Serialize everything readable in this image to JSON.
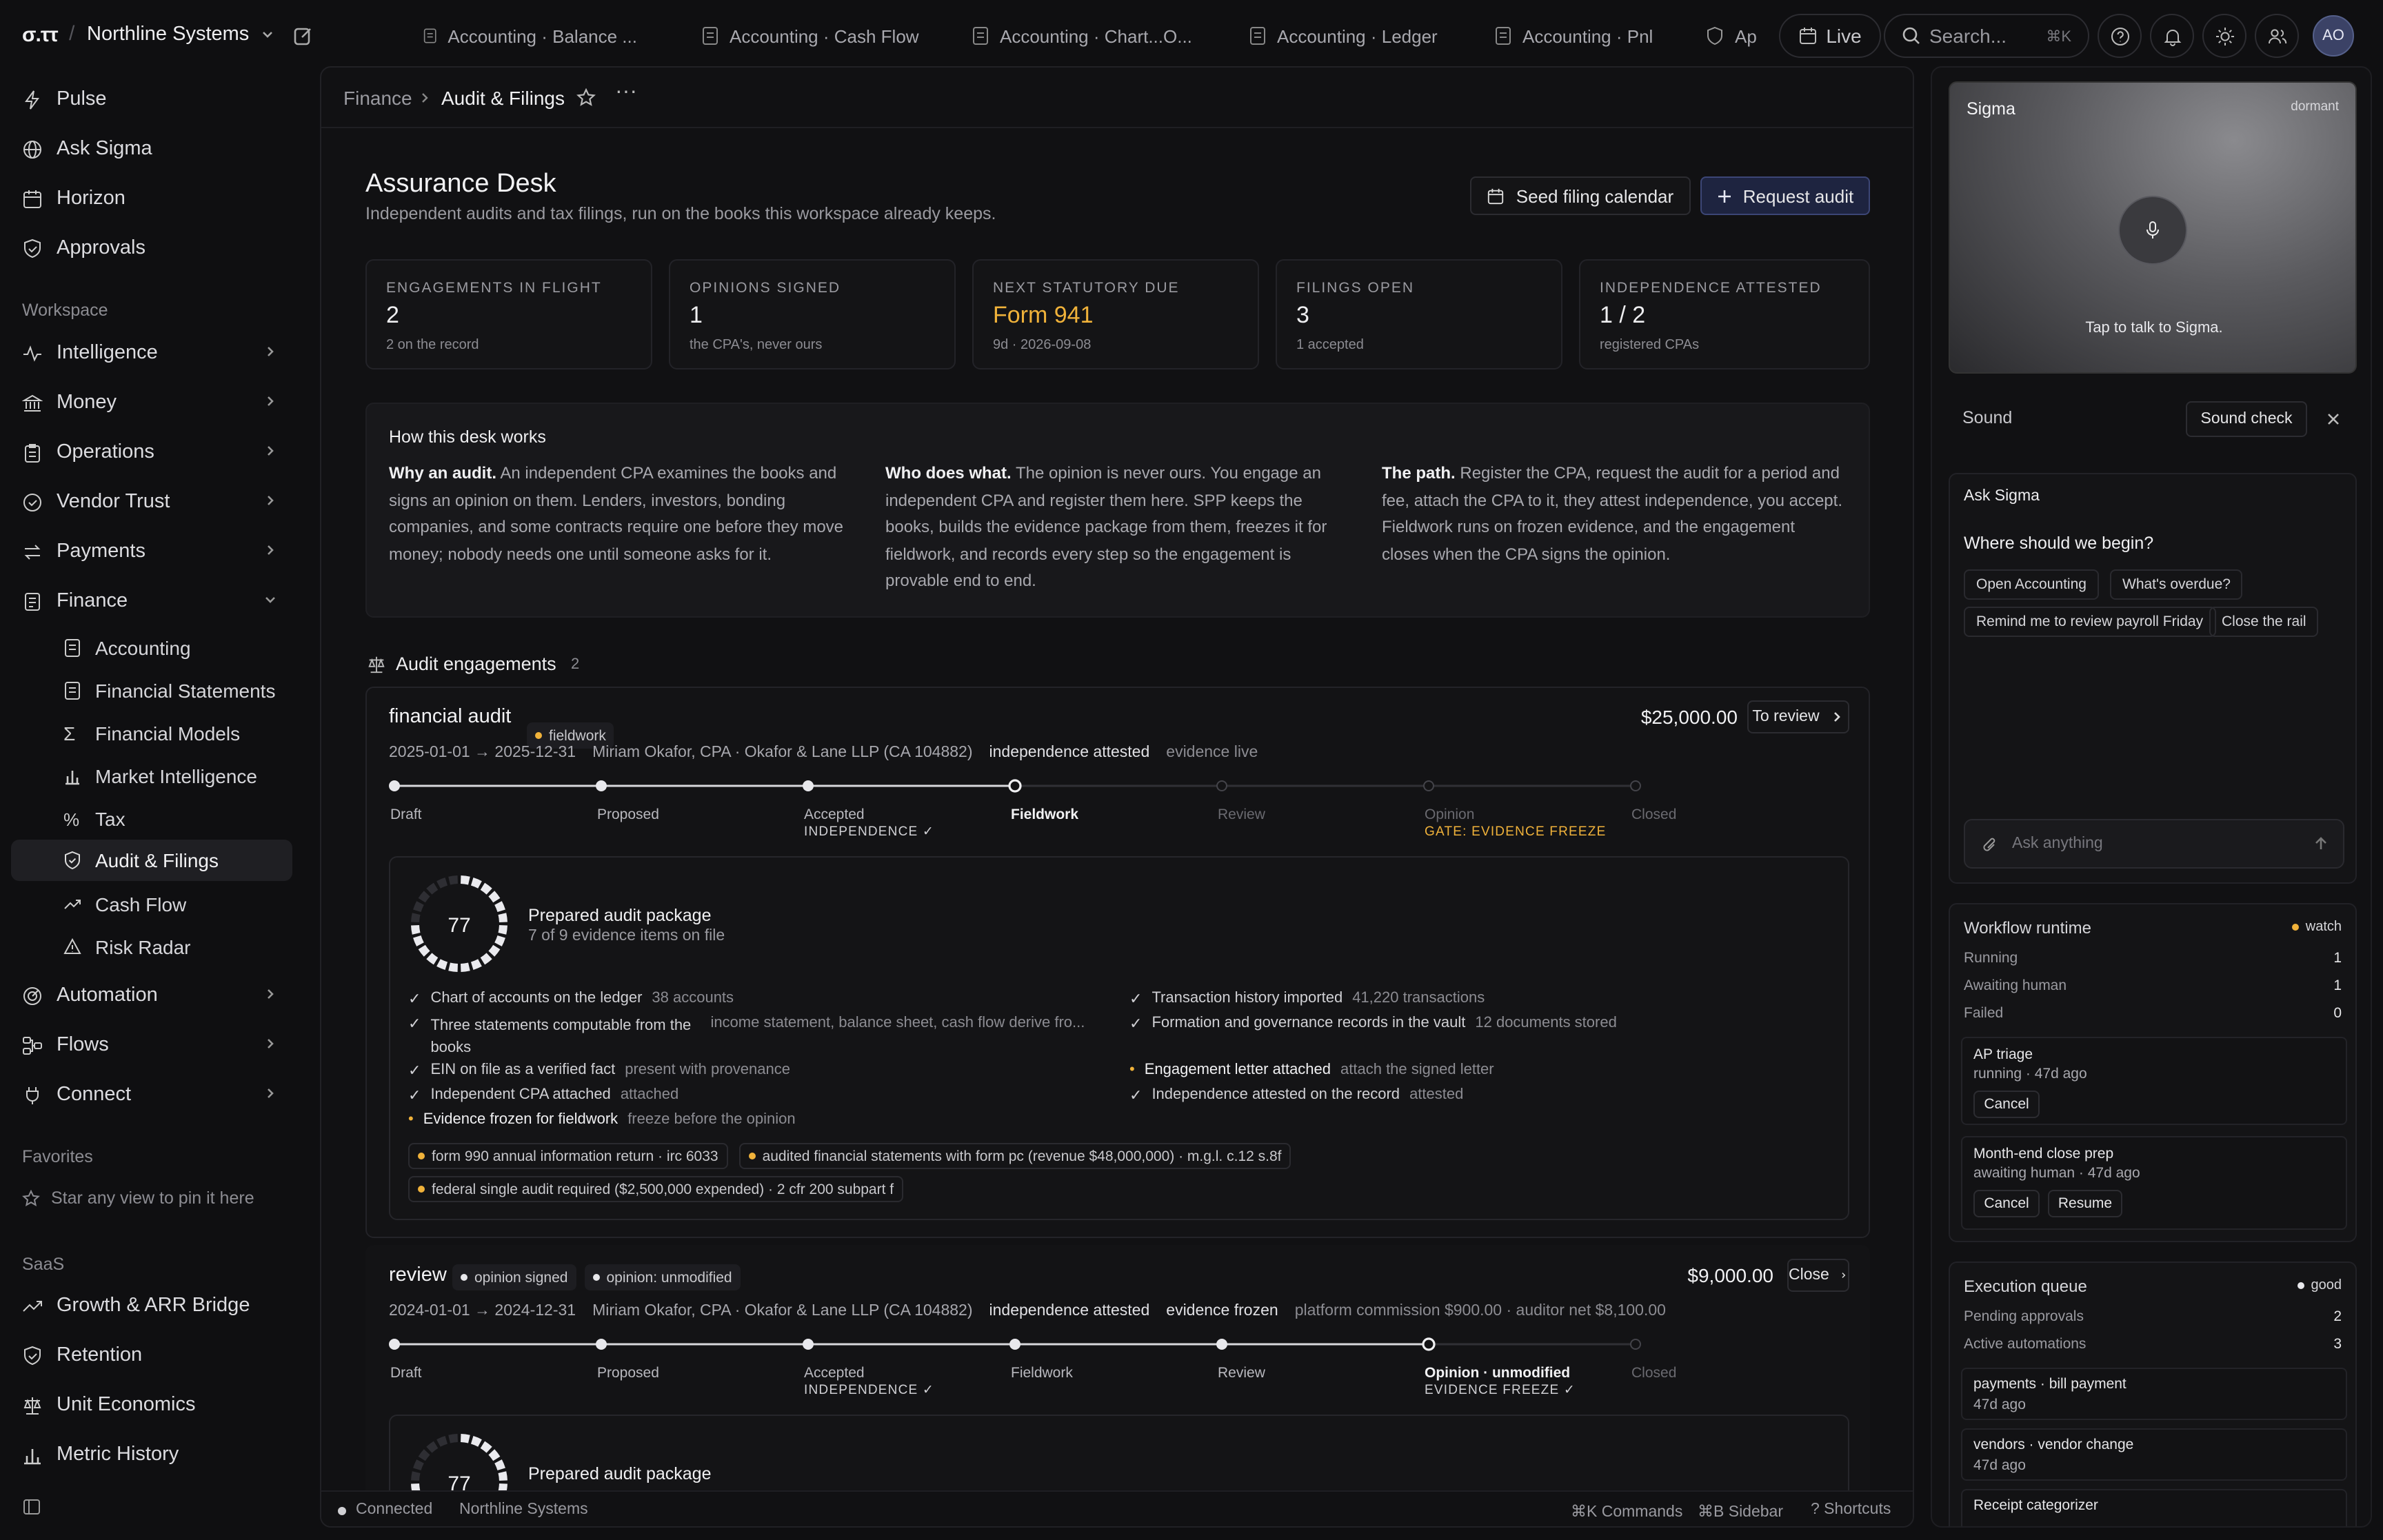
{
  "app": {
    "logo": "σ.ττ",
    "workspace": "Northline Systems",
    "user_initials": "AO"
  },
  "tabs": [
    {
      "label": "Accounting · Balance ..."
    },
    {
      "label": "Accounting · Cash Flow"
    },
    {
      "label": "Accounting · Chart...O..."
    },
    {
      "label": "Accounting · Ledger"
    },
    {
      "label": "Accounting · Pnl"
    },
    {
      "label": "Ap"
    }
  ],
  "topbar": {
    "live_label": "Live",
    "search_placeholder": "Search...",
    "search_shortcut": "⌘K"
  },
  "sidebar": {
    "top_items": [
      {
        "label": "Pulse"
      },
      {
        "label": "Ask Sigma"
      },
      {
        "label": "Horizon"
      },
      {
        "label": "Approvals"
      }
    ],
    "workspace_label": "Workspace",
    "workspace_items": [
      {
        "label": "Intelligence"
      },
      {
        "label": "Money"
      },
      {
        "label": "Operations"
      },
      {
        "label": "Vendor Trust"
      },
      {
        "label": "Payments"
      },
      {
        "label": "Finance"
      }
    ],
    "finance_items": [
      {
        "label": "Accounting"
      },
      {
        "label": "Financial Statements"
      },
      {
        "label": "Financial Models"
      },
      {
        "label": "Market Intelligence"
      },
      {
        "label": "Tax"
      },
      {
        "label": "Audit & Filings"
      },
      {
        "label": "Cash Flow"
      },
      {
        "label": "Risk Radar"
      }
    ],
    "more_items": [
      {
        "label": "Automation"
      },
      {
        "label": "Flows"
      },
      {
        "label": "Connect"
      }
    ],
    "favorites_label": "Favorites",
    "favorites_empty": "Star any view to pin it here",
    "saas_label": "SaaS",
    "saas_items": [
      {
        "label": "Growth & ARR Bridge"
      },
      {
        "label": "Retention"
      },
      {
        "label": "Unit Economics"
      },
      {
        "label": "Metric History"
      }
    ]
  },
  "breadcrumb": {
    "parent": "Finance",
    "current": "Audit & Filings"
  },
  "page": {
    "title": "Assurance Desk",
    "subtitle": "Independent audits and tax filings, run on the books this workspace already keeps.",
    "seed_button": "Seed filing calendar",
    "request_button": "Request audit"
  },
  "kpis": [
    {
      "label": "ENGAGEMENTS IN FLIGHT",
      "value": "2",
      "sub": "2 on the record"
    },
    {
      "label": "OPINIONS SIGNED",
      "value": "1",
      "sub": "the CPA's, never ours"
    },
    {
      "label": "NEXT STATUTORY DUE",
      "value": "Form 941",
      "sub": "9d · 2026-09-08"
    },
    {
      "label": "FILINGS OPEN",
      "value": "3",
      "sub": "1 accepted"
    },
    {
      "label": "INDEPENDENCE ATTESTED",
      "value": "1 / 2",
      "sub": "registered CPAs"
    }
  ],
  "how": {
    "title": "How this desk works",
    "cols": [
      {
        "head": "Why an audit.",
        "body": "An independent CPA examines the books and signs an opinion on them. Lenders, investors, bonding companies, and some contracts require one before they move money; nobody needs one until someone asks for it."
      },
      {
        "head": "Who does what.",
        "body": "The opinion is never ours. You engage an independent CPA and register them here. SPP keeps the books, builds the evidence package from them, freezes it for fieldwork, and records every step so the engagement is provable end to end."
      },
      {
        "head": "The path.",
        "body": "Register the CPA, request the audit for a period and fee, attach the CPA to it, they attest independence, you accept. Fieldwork runs on frozen evidence, and the engagement closes when the CPA signs the opinion."
      }
    ]
  },
  "engagements": {
    "title": "Audit engagements",
    "count": "2",
    "items": [
      {
        "name": "financial audit",
        "status": "fieldwork",
        "amount": "$25,000.00",
        "action": "To review",
        "period": "2025-01-01 → 2025-12-31",
        "auditor": "Miriam Okafor, CPA · Okafor & Lane LLP (CA 104882)",
        "flag1": "independence attested",
        "flag2": "evidence live",
        "steps": [
          "Draft",
          "Proposed",
          "Accepted",
          "Fieldwork",
          "Review",
          "Opinion",
          "Closed"
        ],
        "accepted_sub": "INDEPENDENCE ✓",
        "opinion_sub": "GATE: EVIDENCE FREEZE",
        "package": {
          "score": "77",
          "score_pct": 77,
          "title": "Prepared audit package",
          "sub": "7 of 9 evidence items on file",
          "left": [
            {
              "label": "Chart of accounts on the ledger",
              "meta": "38 accounts",
              "done": true
            },
            {
              "label": "Three statements computable from the books",
              "meta": "income statement, balance sheet, cash flow derive fro...",
              "done": true
            },
            {
              "label": "EIN on file as a verified fact",
              "meta": "present with provenance",
              "done": true
            },
            {
              "label": "Independent CPA attached",
              "meta": "attached",
              "done": true
            },
            {
              "label": "Evidence frozen for fieldwork",
              "meta": "freeze before the opinion",
              "done": false
            }
          ],
          "right": [
            {
              "label": "Transaction history imported",
              "meta": "41,220 transactions",
              "done": true
            },
            {
              "label": "Formation and governance records in the vault",
              "meta": "12 documents stored",
              "done": true
            },
            {
              "label": "Engagement letter attached",
              "meta": "attach the signed letter",
              "done": false
            },
            {
              "label": "Independence attested on the record",
              "meta": "attested",
              "done": true
            }
          ],
          "tags": [
            "form 990 annual information return · irc 6033",
            "audited financial statements with form pc (revenue $48,000,000) · m.g.l. c.12 s.8f",
            "federal single audit required ($2,500,000 expended) · 2 cfr 200 subpart f"
          ]
        }
      },
      {
        "name": "review",
        "status1": "opinion signed",
        "status2": "opinion: unmodified",
        "amount": "$9,000.00",
        "action": "Close",
        "period": "2024-01-01 → 2024-12-31",
        "auditor": "Miriam Okafor, CPA · Okafor & Lane LLP (CA 104882)",
        "flag1": "independence attested",
        "flag2": "evidence frozen",
        "flag3": "platform commission $900.00 · auditor net $8,100.00",
        "steps": [
          "Draft",
          "Proposed",
          "Accepted",
          "Fieldwork",
          "Review",
          "Opinion · unmodified",
          "Closed"
        ],
        "accepted_sub": "INDEPENDENCE ✓",
        "opinion_sub": "EVIDENCE FREEZE ✓",
        "package": {
          "score": "77",
          "score_pct": 77,
          "title": "Prepared audit package"
        }
      }
    ]
  },
  "statusbar": {
    "connected": "Connected",
    "workspace": "Northline Systems",
    "commands": "⌘K Commands",
    "sidebar": "⌘B Sidebar",
    "shortcuts": "? Shortcuts"
  },
  "sigma": {
    "title": "Sigma",
    "state": "dormant",
    "tap": "Tap to talk to Sigma."
  },
  "sound": {
    "label": "Sound",
    "check": "Sound check"
  },
  "ask": {
    "title": "Ask Sigma",
    "question": "Where should we begin?",
    "suggestions": [
      "Open Accounting",
      "What's overdue?",
      "Remind me to review payroll Friday",
      "Close the rail"
    ],
    "placeholder": "Ask anything"
  },
  "workflow": {
    "title": "Workflow runtime",
    "status": "watch",
    "rows": [
      {
        "label": "Running",
        "value": "1"
      },
      {
        "label": "Awaiting human",
        "value": "1"
      },
      {
        "label": "Failed",
        "value": "0"
      }
    ],
    "jobs": [
      {
        "name": "AP triage",
        "meta": "running · 47d ago",
        "buttons": [
          "Cancel"
        ]
      },
      {
        "name": "Month-end close prep",
        "meta": "awaiting human · 47d ago",
        "buttons": [
          "Cancel",
          "Resume"
        ]
      }
    ]
  },
  "queue": {
    "title": "Execution queue",
    "status": "good",
    "rows": [
      {
        "label": "Pending approvals",
        "value": "2"
      },
      {
        "label": "Active automations",
        "value": "3"
      }
    ],
    "items": [
      {
        "name": "payments · bill payment",
        "meta": "47d ago"
      },
      {
        "name": "vendors · vendor change",
        "meta": "47d ago"
      },
      {
        "name": "Receipt categorizer",
        "meta": ""
      }
    ]
  },
  "colors": {
    "accent": "#f0b23a",
    "bg": "#0f0f11",
    "primary_btn": "#1e2440"
  }
}
